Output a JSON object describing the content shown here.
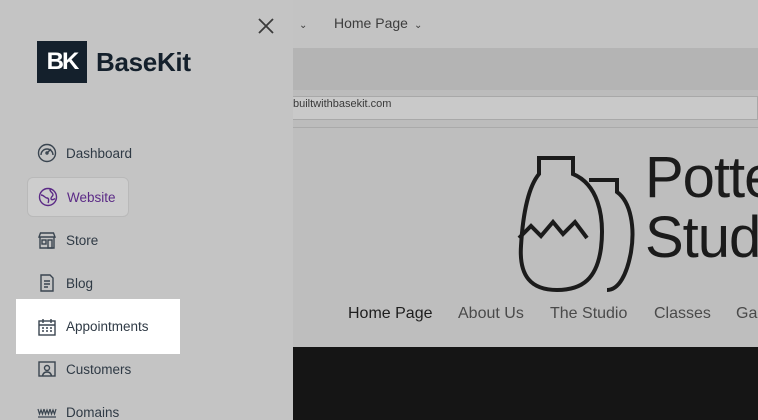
{
  "background": {
    "topbar_dropdowns": [
      {
        "label": ""
      },
      {
        "label": "Home Page"
      }
    ],
    "url": "builtwithbasekit.com",
    "site_logo_text": [
      "Potte",
      "Stud"
    ],
    "site_nav": [
      "Home Page",
      "About Us",
      "The Studio",
      "Classes",
      "Ga"
    ]
  },
  "drawer": {
    "brand": {
      "mark": "BK",
      "name": "BaseKit"
    },
    "items": [
      {
        "label": "Dashboard",
        "icon": "dashboard-icon"
      },
      {
        "label": "Website",
        "icon": "globe-icon",
        "selected": true
      },
      {
        "label": "Store",
        "icon": "store-icon"
      },
      {
        "label": "Blog",
        "icon": "blog-icon"
      },
      {
        "label": "Appointments",
        "icon": "calendar-icon",
        "highlighted": true
      },
      {
        "label": "Customers",
        "icon": "customers-icon"
      },
      {
        "label": "Domains",
        "icon": "www-icon"
      }
    ]
  },
  "colors": {
    "brand": "#14202c",
    "accent": "#5b2a86",
    "highlight": "#ffffff"
  }
}
